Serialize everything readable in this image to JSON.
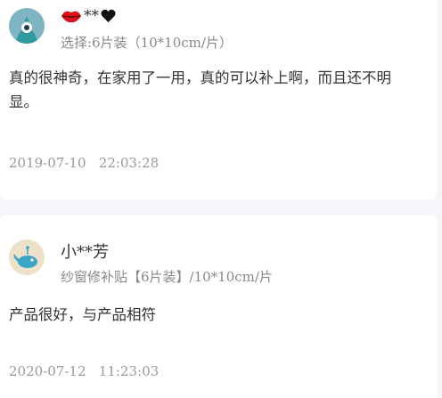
{
  "reviews": [
    {
      "user_name": "**",
      "spec": "选择:6片装（10*10cm/片）",
      "content": "真的很神奇，在家用了一用，真的可以补上啊，而且还不明显。",
      "date": "2019-07-10   22:03:28",
      "avatar": "teal-cartoon-avatar",
      "name_icons": [
        "lips-icon",
        "heart-icon"
      ]
    },
    {
      "user_name": "小**芳",
      "spec": "纱窗修补贴【6片装】/10*10cm/片",
      "content": "产品很好，与产品相符",
      "date": "2020-07-12   11:23:03",
      "avatar": "beige-cartoon-avatar"
    }
  ],
  "colors": {
    "background": "#f4f6f9",
    "card": "#ffffff",
    "text_primary": "#333333",
    "text_secondary": "#888888",
    "text_date": "#999999",
    "lips_red": "#d9141b"
  }
}
